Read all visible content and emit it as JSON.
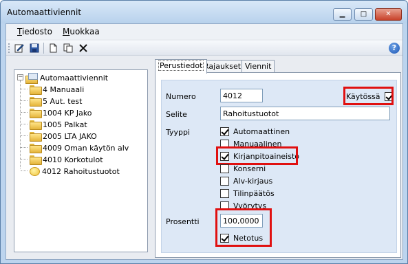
{
  "window": {
    "title": "Automaattiviennit",
    "controls": {
      "minimize": "▁",
      "maximize": "□",
      "close": "✕"
    }
  },
  "menubar": {
    "items": [
      {
        "label": "Tiedosto",
        "accel": "T",
        "rest": "iedosto"
      },
      {
        "label": "Muokkaa",
        "accel": "M",
        "rest": "uokkaa"
      }
    ]
  },
  "toolbar": {
    "icons": [
      "edit-icon",
      "save-icon",
      "new-document-icon",
      "copy-document-icon",
      "delete-icon",
      "help-icon"
    ],
    "help_label": "?"
  },
  "tree": {
    "root": "Automaattiviennit",
    "items": [
      {
        "label": "4 Manuaali",
        "icon": "folder-icon"
      },
      {
        "label": "5 Aut. test",
        "icon": "folder-icon"
      },
      {
        "label": "1004 KP Jako",
        "icon": "folder-icon"
      },
      {
        "label": "1005 Palkat",
        "icon": "folder-icon"
      },
      {
        "label": "2005 LTA JAKO",
        "icon": "folder-icon"
      },
      {
        "label": "4009 Oman käytön alv",
        "icon": "folder-icon"
      },
      {
        "label": "4010 Korkotulot",
        "icon": "folder-icon"
      },
      {
        "label": "4012 Rahoitustuotot",
        "icon": "coin-icon"
      }
    ]
  },
  "tabs": [
    {
      "label": "Perustiedot",
      "active": true
    },
    {
      "label": "Rajaukset",
      "active": false
    },
    {
      "label": "Viennit",
      "active": false
    }
  ],
  "form": {
    "numero_label": "Numero",
    "numero_value": "4012",
    "kaytossa_label": "Käytössä",
    "kaytossa_checked": true,
    "selite_label": "Selite",
    "selite_value": "Rahoitustuotot",
    "tyyppi_label": "Tyyppi",
    "tyyppi_options": [
      {
        "label": "Automaattinen",
        "checked": true
      },
      {
        "label": "Manuaalinen",
        "checked": false
      },
      {
        "label": "Kirjanpitoaineisto",
        "checked": true
      },
      {
        "label": "Konserni",
        "checked": false
      },
      {
        "label": "Alv-kirjaus",
        "checked": false
      },
      {
        "label": "Tilinpäätös",
        "checked": false
      },
      {
        "label": "Vyörytys",
        "checked": false
      }
    ],
    "prosentti_label": "Prosentti",
    "prosentti_value": "100,0000",
    "netotus_label": "Netotus",
    "netotus_checked": true
  },
  "colors": {
    "highlight": "#e01010",
    "panel_bg": "#dde8f6"
  }
}
